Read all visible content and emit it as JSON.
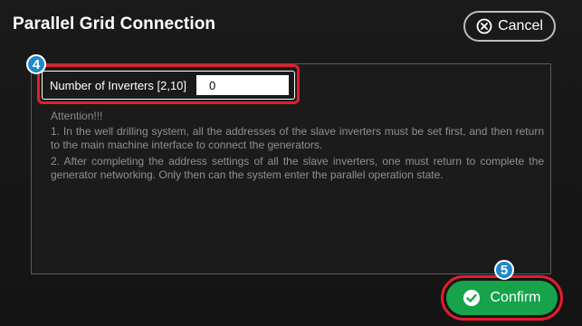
{
  "dialog": {
    "title": "Parallel Grid Connection",
    "cancel_label": "Cancel",
    "confirm_label": "Confirm"
  },
  "field": {
    "label": "Number of Inverters [2,10]",
    "value": "0"
  },
  "markers": {
    "field_step": "4",
    "confirm_step": "5"
  },
  "notes": {
    "heading": "Attention!!!",
    "items": [
      "1. In the well drilling system, all the addresses of the slave inverters must be set first, and then return to the main machine interface to connect the generators.",
      "2. After completing the address settings of all the slave inverters, one must return to complete the generator networking. Only then can the system enter the parallel operation state."
    ]
  },
  "icons": {
    "cancel": "close-circle-icon",
    "confirm": "check-circle-icon"
  },
  "colors": {
    "background": "#141414",
    "confirm": "#16a34a",
    "highlight": "#e41d2d",
    "marker": "#1f88cc"
  }
}
